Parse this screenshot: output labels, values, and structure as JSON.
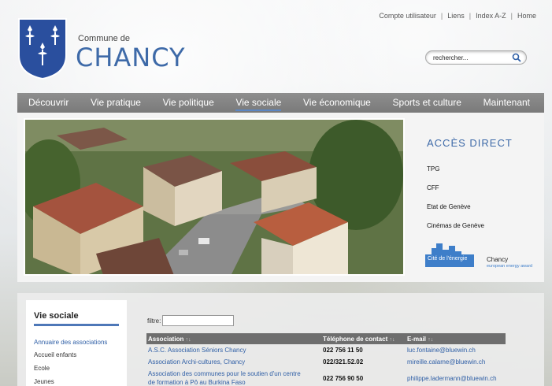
{
  "header": {
    "commune_small": "Commune de",
    "commune_name": "CHANCY",
    "util_links": [
      "Compte utilisateur",
      "Liens",
      "Index A-Z",
      "Home"
    ],
    "search_placeholder": "rechercher..."
  },
  "nav": {
    "items": [
      "Découvrir",
      "Vie pratique",
      "Vie politique",
      "Vie sociale",
      "Vie économique",
      "Sports et culture",
      "Maintenant"
    ],
    "active": "Vie sociale"
  },
  "acces": {
    "title": "ACCÈS DIRECT",
    "links": [
      "TPG",
      "CFF",
      "Etat de Genève",
      "Cinémas de Genève"
    ],
    "badge_left": "Cité de l'énergie",
    "badge_right": "Chancy",
    "badge_sub": "european energy award"
  },
  "sidebar": {
    "title": "Vie sociale",
    "items": [
      "Annuaire des associations",
      "Accueil enfants",
      "Ecole",
      "Jeunes"
    ],
    "active_index": 0
  },
  "filter": {
    "label": "filtre:",
    "value": ""
  },
  "table": {
    "columns": [
      "Association",
      "Téléphone de contact",
      "E-mail"
    ],
    "sort_icon": "↑↓",
    "rows": [
      {
        "name": "A.S.C. Association Séniors Chancy",
        "phone": "022 756 11 50",
        "email": "luc.fontaine@bluewin.ch"
      },
      {
        "name": "Association Archi-cultures, Chancy",
        "phone": "022/321.52.02",
        "email": "mireille.calame@bluewin.ch"
      },
      {
        "name": "Association des communes pour le soutien d'un centre",
        "name2": "de formation à Pô au Burkina Faso",
        "phone": "022 756 90 50",
        "email": "philippe.ladermann@bluewin.ch"
      }
    ]
  },
  "colors": {
    "brand_blue": "#3e6aa8",
    "nav_gray": "#7a7a7a",
    "link_blue": "#2f5fa6"
  }
}
